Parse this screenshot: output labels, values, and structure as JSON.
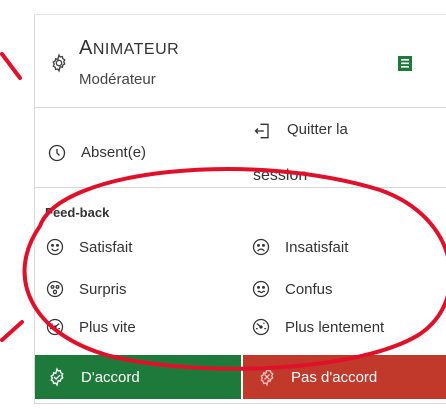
{
  "header": {
    "role_initial": "A",
    "role_rest": "NIMATEUR",
    "subtitle": "Modérateur"
  },
  "status": {
    "absent": "Absent(e)",
    "quit_line1": "Quitter la",
    "quit_line2": "session"
  },
  "feedback": {
    "title": "Feed-back",
    "items": [
      {
        "label": "Satisfait",
        "icon": "smile-icon"
      },
      {
        "label": "Insatisfait",
        "icon": "frown-icon"
      },
      {
        "label": "Surpris",
        "icon": "surprised-icon"
      },
      {
        "label": "Confus",
        "icon": "confused-icon"
      },
      {
        "label": "Plus vite",
        "icon": "speed-fast-icon"
      },
      {
        "label": "Plus lentement",
        "icon": "speed-slow-icon"
      }
    ]
  },
  "buttons": {
    "agree": "D'accord",
    "disagree": "Pas d'accord"
  },
  "colors": {
    "agree_bg": "#1e7a3a",
    "disagree_bg": "#c0392b",
    "annotation": "#e0102a"
  }
}
